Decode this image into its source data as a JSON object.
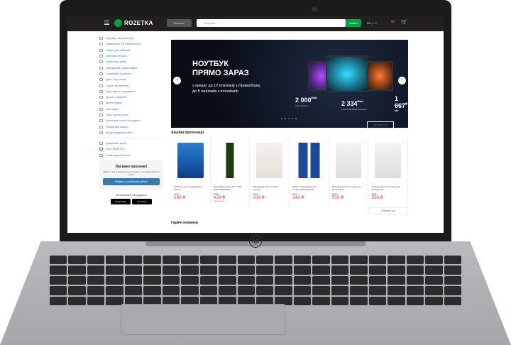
{
  "header": {
    "logo": "ROZETKA",
    "catalog": "Каталог",
    "search_placeholder": "Я шукаю...",
    "search_button": "Знайти",
    "lang_ru": "RU",
    "lang_ua": "UA"
  },
  "sidebar": {
    "categories": [
      "Ноутбуки та комп'ютери",
      "Смартфони, ТВ і електроніка",
      "Товари для геймерів",
      "Побутова техніка",
      "Товари для дому",
      "Інструменти та автотовари",
      "Сантехніка та ремонт",
      "Дача, сад і город",
      "Спорт і захоплення",
      "Одяг, взуття та прикраси",
      "Краса та здоров'я",
      "Дитячі товари",
      "Зоотовари",
      "Офіс, школа, книги",
      "Алкогольні напої та продукти",
      "Товари для бізнесу",
      "Вигідні знижки до 45%"
    ],
    "links": [
      "Довідковий центр",
      "Чат з ROZETKA",
      "Точки видачі Rozetka"
    ],
    "welcome_title": "Ласкаво просимо!",
    "welcome_text": "Увійдіть, щоб отримувати рекомендації, персональні бонуси і знижки.",
    "login_button": "Увійдіть в особистий кабінет",
    "apps_title": "Встановлюйте наші додатки",
    "google_play": "Google Play",
    "app_store": "App Store"
  },
  "banner": {
    "title1": "НОУТБУК",
    "title2": "ПРЯМО ЗАРАЗ",
    "sub1": "у кредит до 12 платежів з ПриватБанк,",
    "sub2": "до 8 платежів з monobank",
    "offers": [
      {
        "price": "2 000",
        "unit": "₴/міс",
        "name": "Acer Aspire 5"
      },
      {
        "price": "2 334",
        "unit": "₴/міс",
        "name": "Lenovo IdeaPad Gaming 3"
      },
      {
        "price": "1 667",
        "unit": "₴/міс",
        "name": "ASUS Laptop"
      }
    ],
    "slide_count": 5,
    "active_slide": 3
  },
  "all_promos": "Всі акції 159",
  "promos_title": "Акційні пропозиції",
  "products": [
    {
      "name": "Таблетки для посудомийних машин",
      "old": "650 ₴",
      "price": "299 ₴",
      "status": ""
    },
    {
      "name": "Лікер Jägermeister 0.7 л 35% (4067700015532)",
      "old": "655 ₴",
      "price": "429 ₴",
      "status": "Закінчується"
    },
    {
      "name": "Наповнювач для котячого туалету",
      "old": "297 ₴",
      "price": "209 ₴",
      "status": ""
    },
    {
      "name": "Набір ополіскувачів для посудомийних машин",
      "old": "464 ₴",
      "price": "349 ₴",
      "status": ""
    },
    {
      "name": "Упаковка вологого корму для кішок Purina",
      "old": "685 ₴",
      "price": "555 ₴",
      "status": ""
    },
    {
      "name": "Упаковка вологого корму для кішок Purina",
      "old": "685 ₴",
      "price": "555 ₴",
      "status": ""
    }
  ],
  "show_more": "Показати ще",
  "new_title": "Гарячі новинки",
  "laptop_brand": "hp",
  "colors": {
    "brand_green": "#00a046",
    "header": "#221f1f",
    "link": "#3e77aa",
    "price_red": "#f84147"
  }
}
